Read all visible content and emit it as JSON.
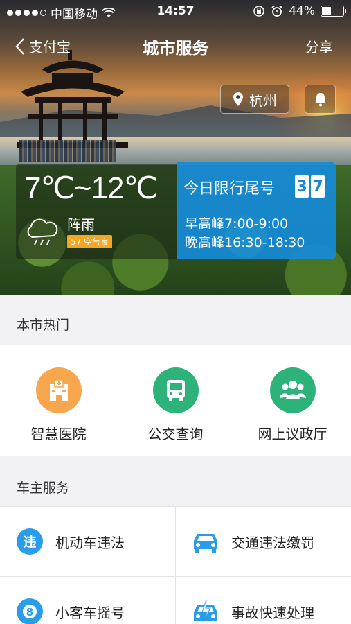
{
  "status_bar": {
    "carrier": "中国移动",
    "time": "14:57",
    "battery_text": "44%",
    "battery_level": 0.44,
    "signal_bars": 4,
    "signal_total": 5
  },
  "nav": {
    "back_label": "支付宝",
    "title": "城市服务",
    "share_label": "分享"
  },
  "city": {
    "name": "杭州"
  },
  "weather": {
    "temperature": "7℃~12℃",
    "condition": "阵雨",
    "aqi": "57 空气良"
  },
  "traffic_limit": {
    "title": "今日限行尾号",
    "numbers": [
      "3",
      "7"
    ],
    "morning": "早高峰7:00-9:00",
    "evening": "晚高峰16:30-18:30"
  },
  "hot": {
    "title": "本市热门",
    "items": [
      {
        "label": "智慧医院",
        "icon": "hospital-icon",
        "color": "#f7a64d"
      },
      {
        "label": "公交查询",
        "icon": "bus-icon",
        "color": "#2db37a"
      },
      {
        "label": "网上议政厅",
        "icon": "people-icon",
        "color": "#2db37a"
      }
    ]
  },
  "car_services": {
    "title": "车主服务",
    "items": [
      {
        "label": "机动车违法",
        "icon": "violation-icon",
        "color": "#2b9de8"
      },
      {
        "label": "交通违法缴罚",
        "icon": "car-icon",
        "color": "#2b9de8"
      },
      {
        "label": "小客车摇号",
        "icon": "lottery-icon",
        "color": "#2b9de8"
      },
      {
        "label": "事故快速处理",
        "icon": "accident-car-icon",
        "color": "#2b9de8"
      }
    ]
  }
}
